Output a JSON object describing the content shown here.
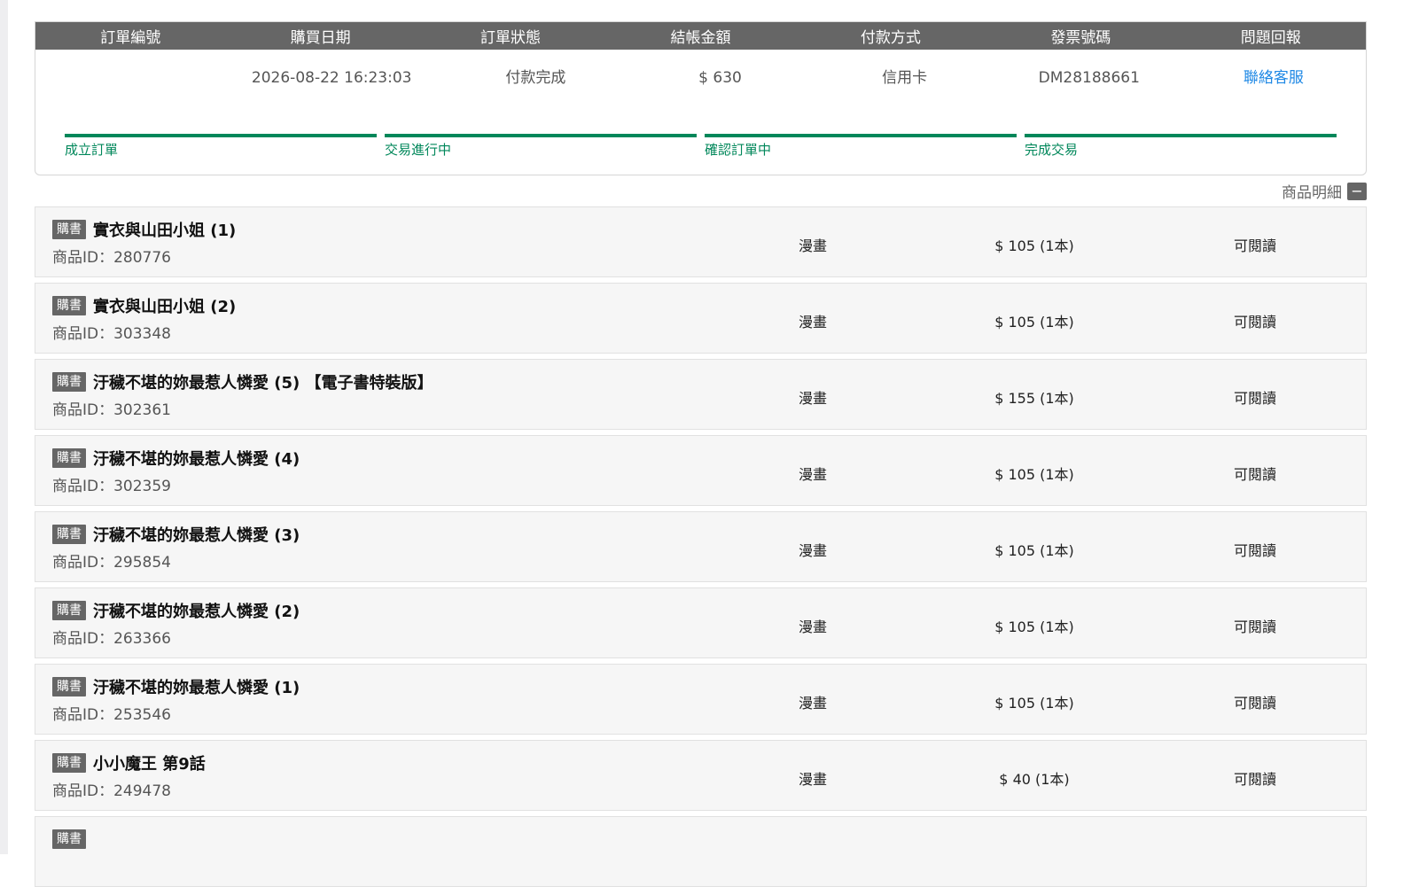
{
  "order": {
    "headers": [
      "訂單編號",
      "購買日期",
      "訂單狀態",
      "結帳金額",
      "付款方式",
      "發票號碼",
      "問題回報"
    ],
    "order_number": "",
    "date": "2026-08-22 16:23:03",
    "status": "付款完成",
    "amount": "$ 630",
    "payment": "信用卡",
    "invoice": "DM28188661",
    "report_link": "聯絡客服",
    "steps": [
      "成立訂單",
      "交易進行中",
      "確認訂單中",
      "完成交易"
    ],
    "colors": {
      "header_bg": "#666666",
      "progress": "#00875a",
      "link": "#1e88e5"
    }
  },
  "detail_toggle": {
    "label": "商品明細",
    "icon": "minus-icon"
  },
  "items": [
    {
      "badge": "購書",
      "title": "實衣與山田小姐 (1)",
      "product_id": "商品ID：280776",
      "category": "漫畫",
      "price": "$ 105 (1本)",
      "status": "可閱讀"
    },
    {
      "badge": "購書",
      "title": "實衣與山田小姐 (2)",
      "product_id": "商品ID：303348",
      "category": "漫畫",
      "price": "$ 105 (1本)",
      "status": "可閱讀"
    },
    {
      "badge": "購書",
      "title": "汙穢不堪的妳最惹人憐愛 (5) 【電子書特裝版】",
      "product_id": "商品ID：302361",
      "category": "漫畫",
      "price": "$ 155 (1本)",
      "status": "可閱讀"
    },
    {
      "badge": "購書",
      "title": "汙穢不堪的妳最惹人憐愛 (4)",
      "product_id": "商品ID：302359",
      "category": "漫畫",
      "price": "$ 105 (1本)",
      "status": "可閱讀"
    },
    {
      "badge": "購書",
      "title": "汙穢不堪的妳最惹人憐愛 (3)",
      "product_id": "商品ID：295854",
      "category": "漫畫",
      "price": "$ 105 (1本)",
      "status": "可閱讀"
    },
    {
      "badge": "購書",
      "title": "汙穢不堪的妳最惹人憐愛 (2)",
      "product_id": "商品ID：263366",
      "category": "漫畫",
      "price": "$ 105 (1本)",
      "status": "可閱讀"
    },
    {
      "badge": "購書",
      "title": "汙穢不堪的妳最惹人憐愛 (1)",
      "product_id": "商品ID：253546",
      "category": "漫畫",
      "price": "$ 105 (1本)",
      "status": "可閱讀"
    },
    {
      "badge": "購書",
      "title": "小小魔王 第9話",
      "product_id": "商品ID：249478",
      "category": "漫畫",
      "price": "$ 40 (1本)",
      "status": "可閱讀"
    },
    {
      "badge": "購書",
      "title": "",
      "product_id": "",
      "category": "",
      "price": "",
      "status": ""
    }
  ]
}
